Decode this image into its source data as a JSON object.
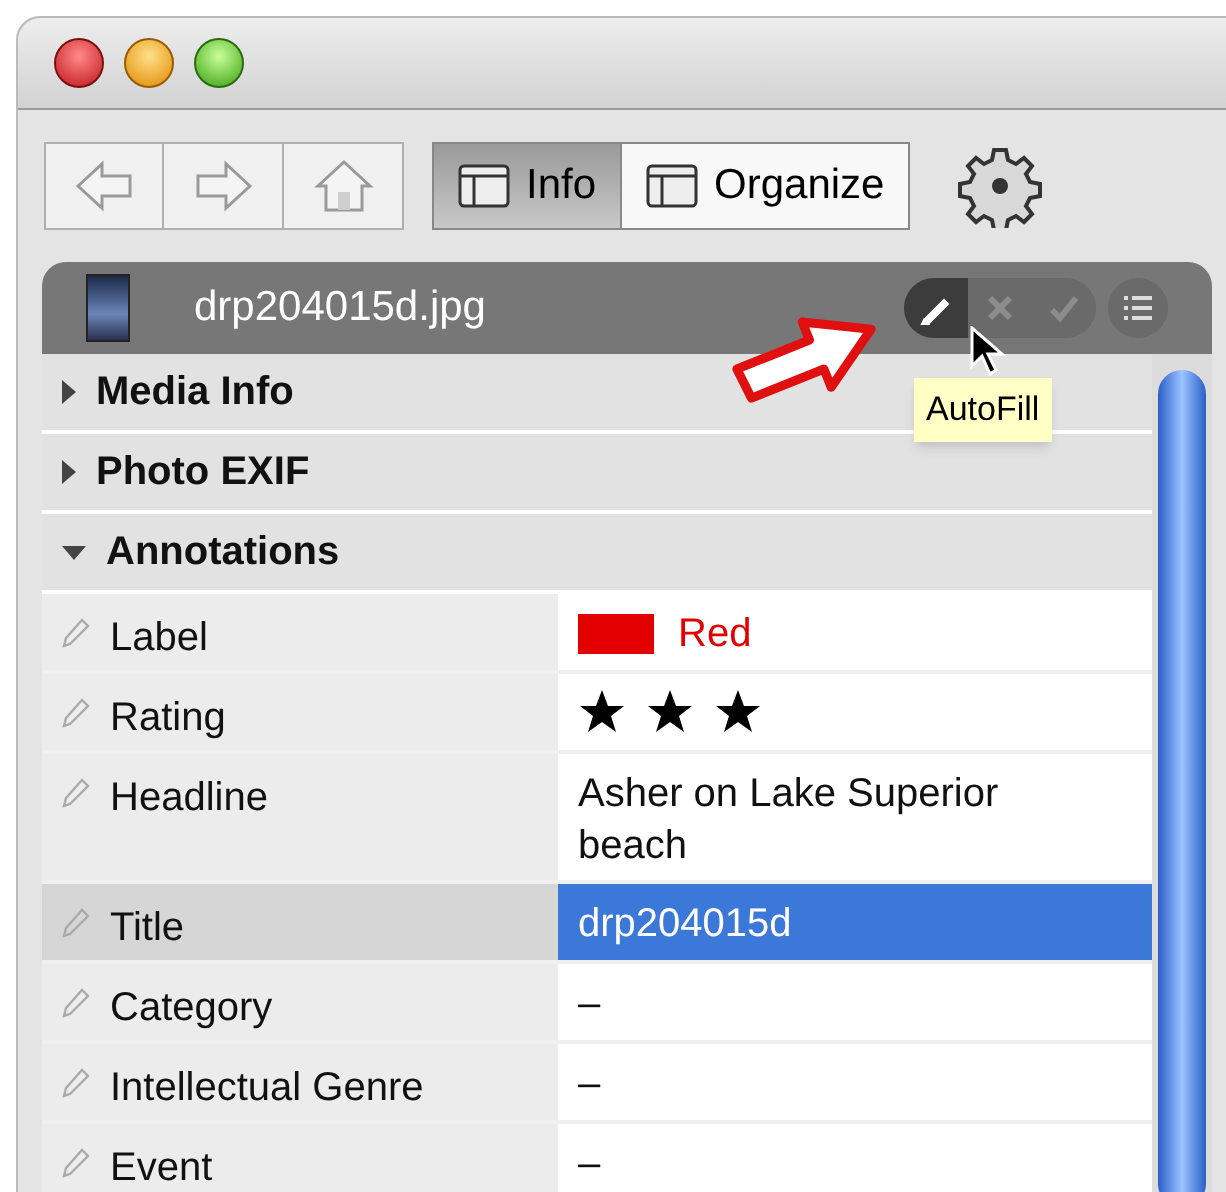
{
  "toolbar": {
    "tabs": [
      {
        "label": "Info",
        "selected": true
      },
      {
        "label": "Organize",
        "selected": false
      }
    ]
  },
  "panel": {
    "file_name": "drp204015d.jpg",
    "actions": [
      {
        "kind": "edit",
        "disabled": false
      },
      {
        "kind": "cancel",
        "disabled": true
      },
      {
        "kind": "confirm",
        "disabled": true
      }
    ],
    "tooltip": "AutoFill",
    "sections": [
      {
        "title": "Media Info",
        "expanded": false
      },
      {
        "title": "Photo EXIF",
        "expanded": false
      },
      {
        "title": "Annotations",
        "expanded": true
      }
    ],
    "fields": [
      {
        "kind": "color",
        "label": "Label",
        "value": "Red",
        "color": "#e50000",
        "selected": false
      },
      {
        "kind": "stars",
        "label": "Rating",
        "stars": 3,
        "selected": false
      },
      {
        "kind": "text",
        "label": "Headline",
        "value": "Asher on Lake Superior beach",
        "selected": false
      },
      {
        "kind": "text",
        "label": "Title",
        "value": "drp204015d",
        "selected": true
      },
      {
        "kind": "text",
        "label": "Category",
        "value": "–",
        "selected": false
      },
      {
        "kind": "text",
        "label": "Intellectual Genre",
        "value": "–",
        "selected": false
      },
      {
        "kind": "text",
        "label": "Event",
        "value": "–",
        "selected": false
      }
    ]
  }
}
